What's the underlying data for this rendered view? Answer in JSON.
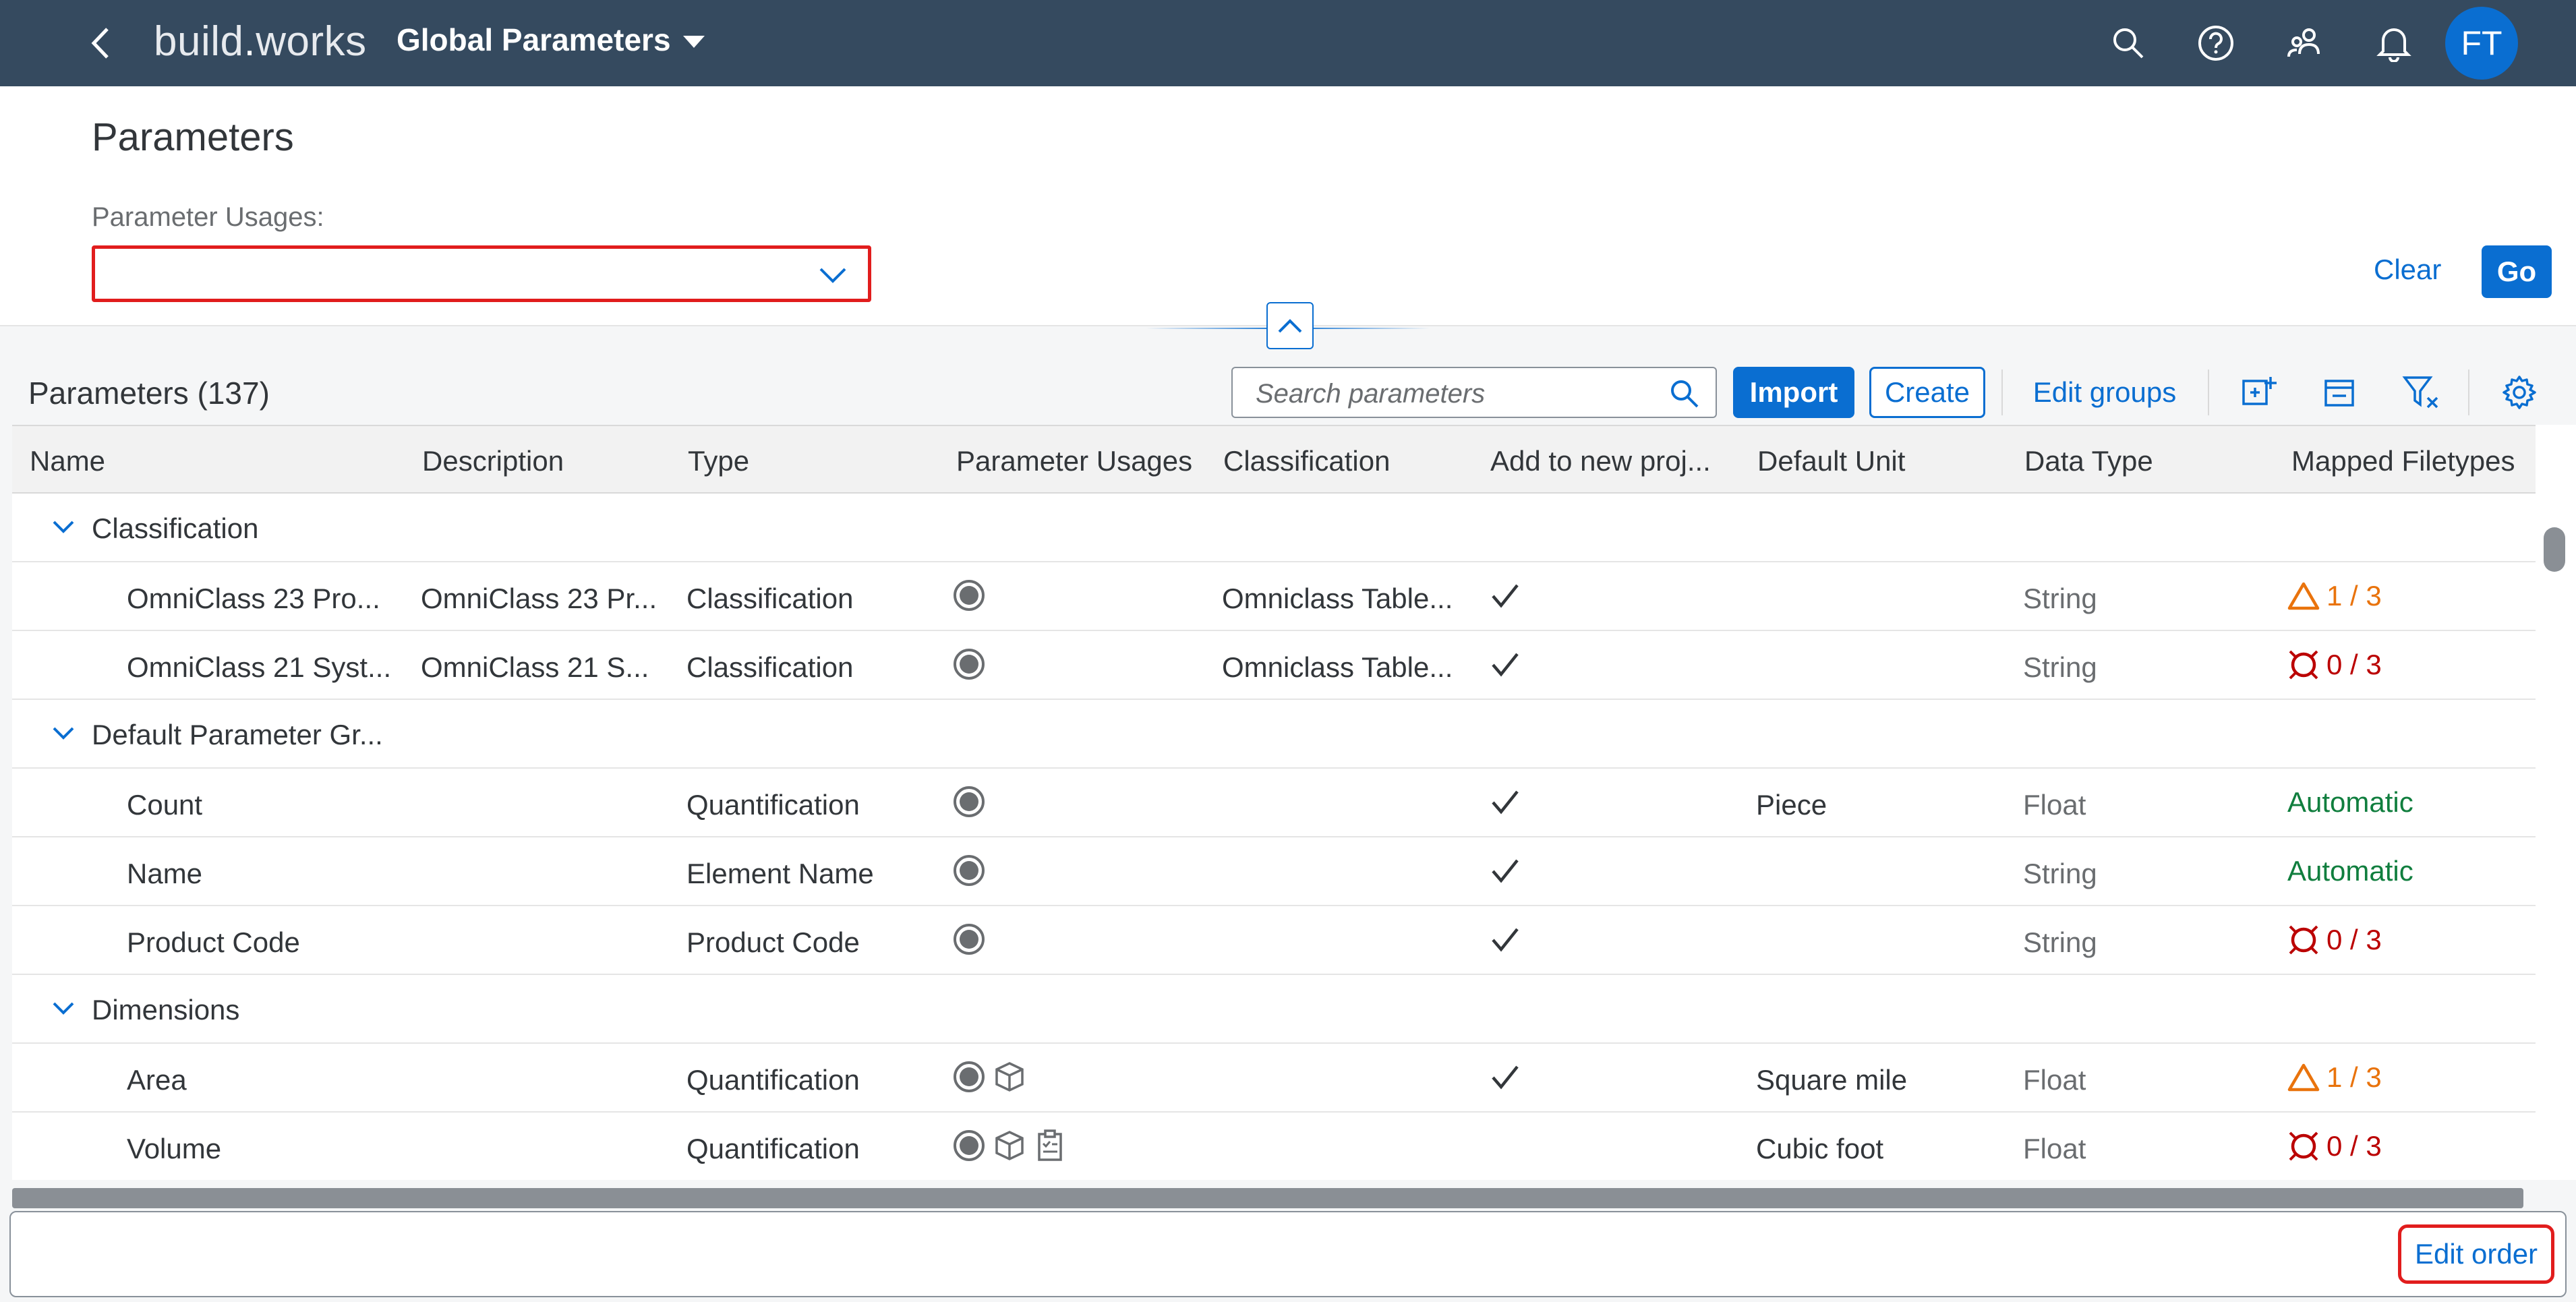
{
  "shell": {
    "logo_part1": "build",
    "logo_dot": ".",
    "logo_part2": "works",
    "title": "Global Parameters",
    "icons": [
      "back-icon",
      "search-icon",
      "help-icon",
      "users-icon",
      "bell-icon"
    ],
    "avatar_initials": "FT",
    "bar_color": "#354a5f"
  },
  "filter": {
    "page_title": "Parameters",
    "usage_label": "Parameter Usages:",
    "usage_value": "",
    "clear_label": "Clear",
    "go_label": "Go"
  },
  "table_toolbar": {
    "title": "Parameters (137)",
    "search_placeholder": "Search parameters",
    "import_label": "Import",
    "create_label": "Create",
    "edit_groups_label": "Edit groups",
    "icons": [
      "add-group-icon",
      "remove-group-icon",
      "clear-filter-icon",
      "settings-icon"
    ]
  },
  "columns": [
    "Name",
    "Description",
    "Type",
    "Parameter Usages",
    "Classification",
    "Add to new proj...",
    "Default Unit",
    "Data Type",
    "Mapped Filetypes"
  ],
  "groups": [
    {
      "label": "Classification",
      "rows": [
        {
          "name": "OmniClass 23 Pro...",
          "description": "OmniClass 23 Pr...",
          "type": "Classification",
          "usages": [
            "radio"
          ],
          "classification": "Omniclass Table...",
          "add_to_new": true,
          "unit": "",
          "data_type": "String",
          "mapped": "1 / 3",
          "mapped_status": "warning"
        },
        {
          "name": "OmniClass 21 Syst...",
          "description": "OmniClass 21 S...",
          "type": "Classification",
          "usages": [
            "radio"
          ],
          "classification": "Omniclass Table...",
          "add_to_new": true,
          "unit": "",
          "data_type": "String",
          "mapped": "0 / 3",
          "mapped_status": "error"
        }
      ]
    },
    {
      "label": "Default Parameter Gr...",
      "rows": [
        {
          "name": "Count",
          "description": "",
          "type": "Quantification",
          "usages": [
            "radio"
          ],
          "classification": "",
          "add_to_new": true,
          "unit": "Piece",
          "data_type": "Float",
          "mapped": "Automatic",
          "mapped_status": "success"
        },
        {
          "name": "Name",
          "description": "",
          "type": "Element Name",
          "usages": [
            "radio"
          ],
          "classification": "",
          "add_to_new": true,
          "unit": "",
          "data_type": "String",
          "mapped": "Automatic",
          "mapped_status": "success"
        },
        {
          "name": "Product Code",
          "description": "",
          "type": "Product Code",
          "usages": [
            "radio"
          ],
          "classification": "",
          "add_to_new": true,
          "unit": "",
          "data_type": "String",
          "mapped": "0 / 3",
          "mapped_status": "error"
        }
      ]
    },
    {
      "label": "Dimensions",
      "rows": [
        {
          "name": "Area",
          "description": "",
          "type": "Quantification",
          "usages": [
            "radio",
            "cube"
          ],
          "classification": "",
          "add_to_new": true,
          "unit": "Square mile",
          "data_type": "Float",
          "mapped": "1 / 3",
          "mapped_status": "warning"
        },
        {
          "name": "Volume",
          "description": "",
          "type": "Quantification",
          "usages": [
            "radio",
            "cube",
            "clipboard"
          ],
          "classification": "",
          "add_to_new": false,
          "unit": "Cubic foot",
          "data_type": "Float",
          "mapped": "0 / 3",
          "mapped_status": "error"
        }
      ]
    }
  ],
  "footer": {
    "edit_order_label": "Edit order"
  },
  "colors": {
    "brand": "#0a6ed1",
    "warning": "#e9730c",
    "error": "#bb0000",
    "success": "#107e3e",
    "highlight": "#e11d1d"
  }
}
